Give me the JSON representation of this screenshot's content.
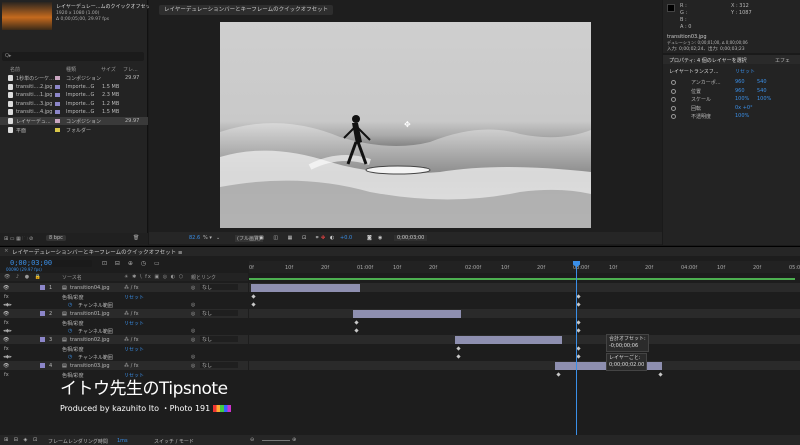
{
  "project": {
    "comp_name": "レイヤーデュレー...ムのクイックオフセット ▾",
    "comp_info_1": "1920 x 1080 (1.00)",
    "comp_info_2": "Δ 0;00;05;00, 29.97 fps",
    "search_placeholder": "Q▸",
    "columns": {
      "name": "名前",
      "type": "種類",
      "size": "サイズ",
      "frame": "フレ..."
    },
    "items": [
      {
        "name": "1秒単のシーケ...",
        "type": "コンポジション",
        "size": "",
        "frame": "29.97",
        "swatch": "#c9a6c0",
        "selected": false
      },
      {
        "name": "transiti....2.jpg",
        "type": "Importe...G",
        "size": "1.5 MB",
        "frame": "",
        "swatch": "#8c86c9",
        "selected": false
      },
      {
        "name": "transiti....1.jpg",
        "type": "Importe...G",
        "size": "2.3 MB",
        "frame": "",
        "swatch": "#8c86c9",
        "selected": false
      },
      {
        "name": "transiti....3.jpg",
        "type": "Importe...G",
        "size": "1.2 MB",
        "frame": "",
        "swatch": "#8c86c9",
        "selected": false
      },
      {
        "name": "transiti....4.jpg",
        "type": "Importe...G",
        "size": "1.5 MB",
        "frame": "",
        "swatch": "#8c86c9",
        "selected": false
      },
      {
        "name": "レイヤーデュ...",
        "type": "コンポジション",
        "size": "",
        "frame": "29.97",
        "swatch": "#c9a6c0",
        "selected": true
      },
      {
        "name": "平面",
        "type": "フォルダー",
        "size": "",
        "frame": "",
        "swatch": "#d9c74a",
        "selected": false
      }
    ],
    "bpc": "8 bpc"
  },
  "viewer": {
    "tab_label": "レイヤーデュレーションバーとキーフレームのクイックオフセット",
    "zoom": "82.6",
    "resolution": "(フル画質)",
    "exposure": "+0.0",
    "timecode": "0;00;03;00"
  },
  "info": {
    "r": "R :",
    "g": "G :",
    "b": "B :",
    "a": "A : 0",
    "x": "X : 312",
    "y": "Y : 1087",
    "file": "transition03.jpg",
    "duration": "デュレーション: 0;00;01;00, ∆ 0;00;00;06",
    "inout": "入力: 0;00;02;24、出力: 0;00;03;23"
  },
  "props": {
    "title": "プロパティ: 4 個のレイヤーを選択",
    "effects_tab": "エフェ",
    "section": "レイヤートランスフ...",
    "reset": "リセット",
    "rows": [
      {
        "label": "アンカーポ...",
        "v1": "960",
        "v2": "540"
      },
      {
        "label": "位置",
        "v1": "960",
        "v2": "540"
      },
      {
        "label": "スケール",
        "v1": "100%",
        "v2": "100%"
      },
      {
        "label": "回転",
        "v1": "0x +0°",
        "v2": ""
      },
      {
        "label": "不透明度",
        "v1": "100%",
        "v2": ""
      }
    ]
  },
  "timeline": {
    "title": "レイヤーデュレーションバーとキーフレームのクイックオフセット ≡",
    "timecode": "0;00;03;00",
    "timecode_sub": "00090 (29.97 fps)",
    "col_source": "ソース名",
    "col_parent": "親とリンク",
    "ruler": [
      "0f",
      "10f",
      "20f",
      "01:00f",
      "10f",
      "20f",
      "02:00f",
      "10f",
      "20f",
      "03:00f",
      "10f",
      "20f",
      "04:00f",
      "10f",
      "20f",
      "05:0"
    ],
    "layers": [
      {
        "num": "1",
        "name": "transition04.jpg",
        "parent": "なし",
        "sub": "色相/彩度",
        "reset": "リセット",
        "channel": "チャンネル範囲"
      },
      {
        "num": "2",
        "name": "transition01.jpg",
        "parent": "なし",
        "sub": "色相/彩度",
        "reset": "リセット",
        "channel": "チャンネル範囲"
      },
      {
        "num": "3",
        "name": "transition02.jpg",
        "parent": "なし",
        "sub": "色相/彩度",
        "reset": "リセット",
        "channel": "チャンネル範囲"
      },
      {
        "num": "4",
        "name": "transition03.jpg",
        "parent": "なし",
        "sub": "色相/彩度",
        "reset": "リセット",
        "channel": ""
      }
    ],
    "tooltip1_a": "合計オフセット:",
    "tooltip1_b": "-0;00;00;06",
    "tooltip2_a": "レイヤーごと:",
    "tooltip2_b": "0;00;00;02.00",
    "footer_render": "フレームレンダリング時間",
    "footer_ms": "1ms",
    "footer_switch": "スイッチ / モード"
  },
  "watermark": {
    "title": "イトウ先生のTipsnote",
    "subtitle": "Produced by kazuhito Ito ・Photo 191"
  }
}
